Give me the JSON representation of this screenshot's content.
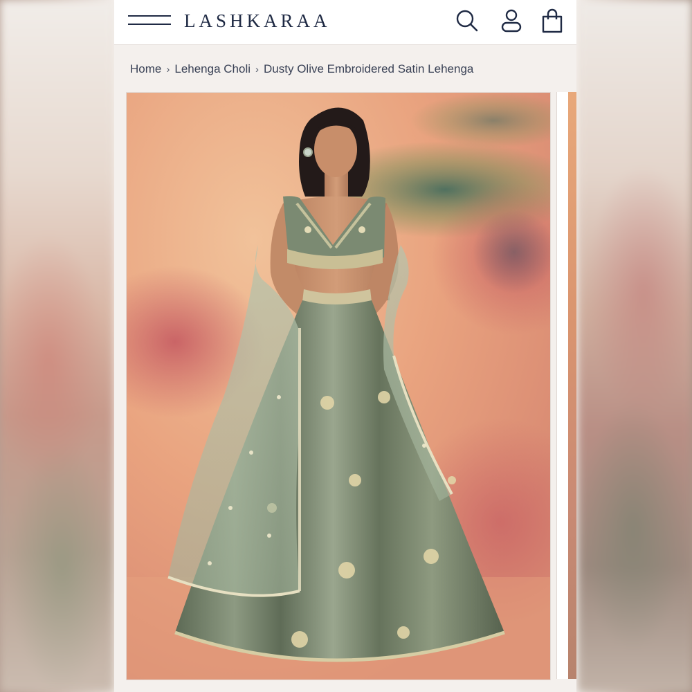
{
  "header": {
    "brand": "LASHKARAA",
    "icons": [
      "menu-icon",
      "search-icon",
      "account-icon",
      "bag-icon"
    ]
  },
  "breadcrumb": {
    "items": [
      "Home",
      "Lehenga Choli",
      "Dusty Olive Embroidered Satin Lehenga"
    ],
    "separator": "›"
  },
  "colors": {
    "brand_navy": "#1f2a44",
    "page_bg": "#f4f0ed",
    "outfit_olive": "#6f7d66",
    "dupatta_sage": "#a9b9a4"
  }
}
